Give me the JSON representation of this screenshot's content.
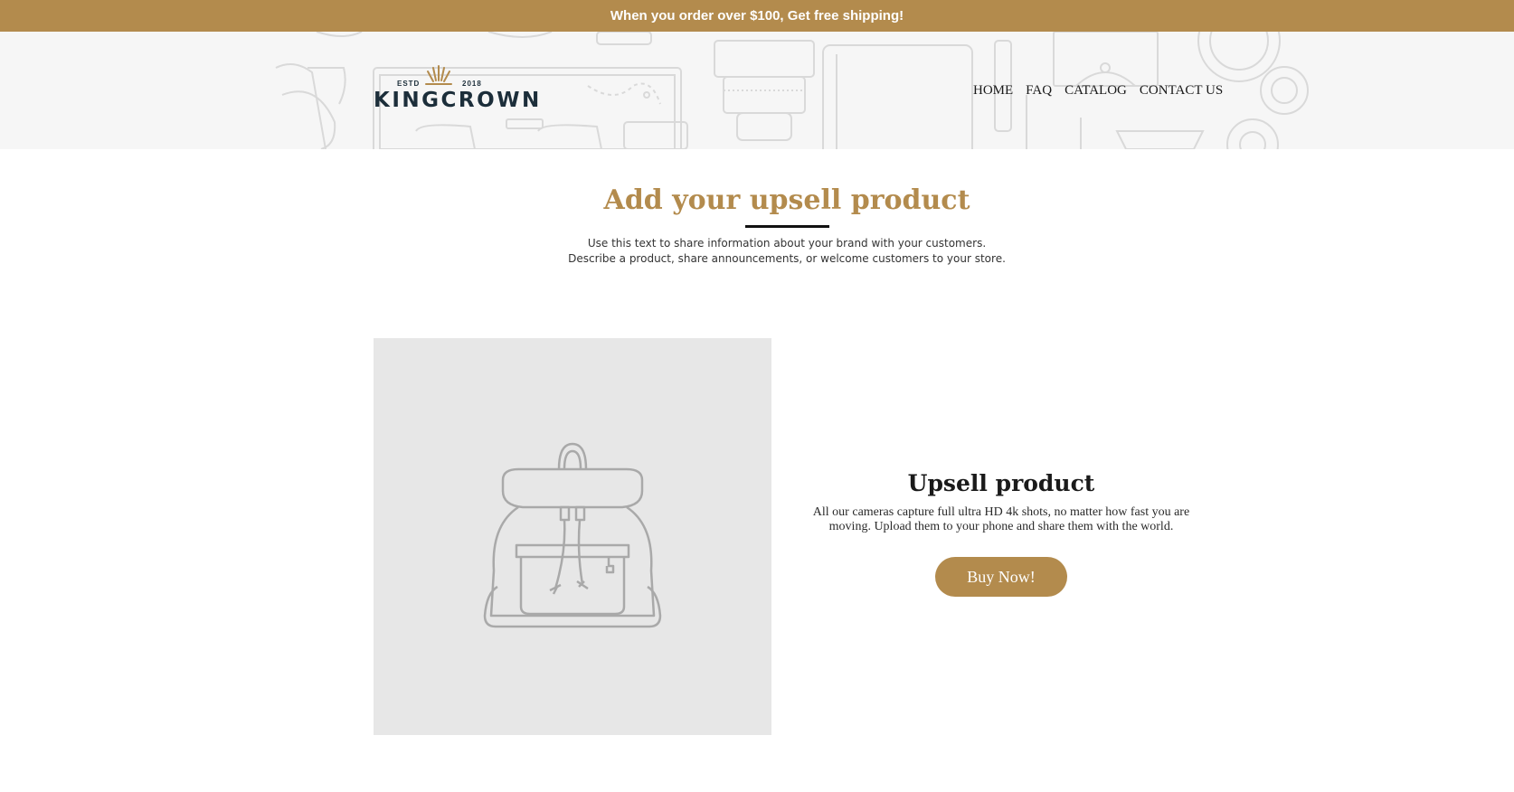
{
  "announcement": {
    "text": "When you order over $100, Get free shipping!"
  },
  "logo": {
    "estd": "ESTD",
    "year": "2018",
    "name": "KINGCROWN"
  },
  "nav": {
    "items": [
      "HOME",
      "FAQ",
      "CATALOG",
      "CONTACT US"
    ]
  },
  "upsell_section": {
    "heading": "Add your upsell product",
    "text_line1": "Use this text to share information about your brand with your customers.",
    "text_line2": "Describe a product, share announcements, or welcome customers to your store."
  },
  "product": {
    "image_icon": "backpack-icon",
    "title": "Upsell product",
    "description_line1": "All our cameras capture full ultra HD 4k shots, no matter how fast you are",
    "description_line2": "moving. Upload them to your phone and share them with the world.",
    "button_label": "Buy Now!"
  },
  "colors": {
    "accent": "#b38b4d",
    "logo_navy": "#1c2e3a",
    "header_bg": "#f6f6f6",
    "image_bg": "#e7e7e7"
  }
}
